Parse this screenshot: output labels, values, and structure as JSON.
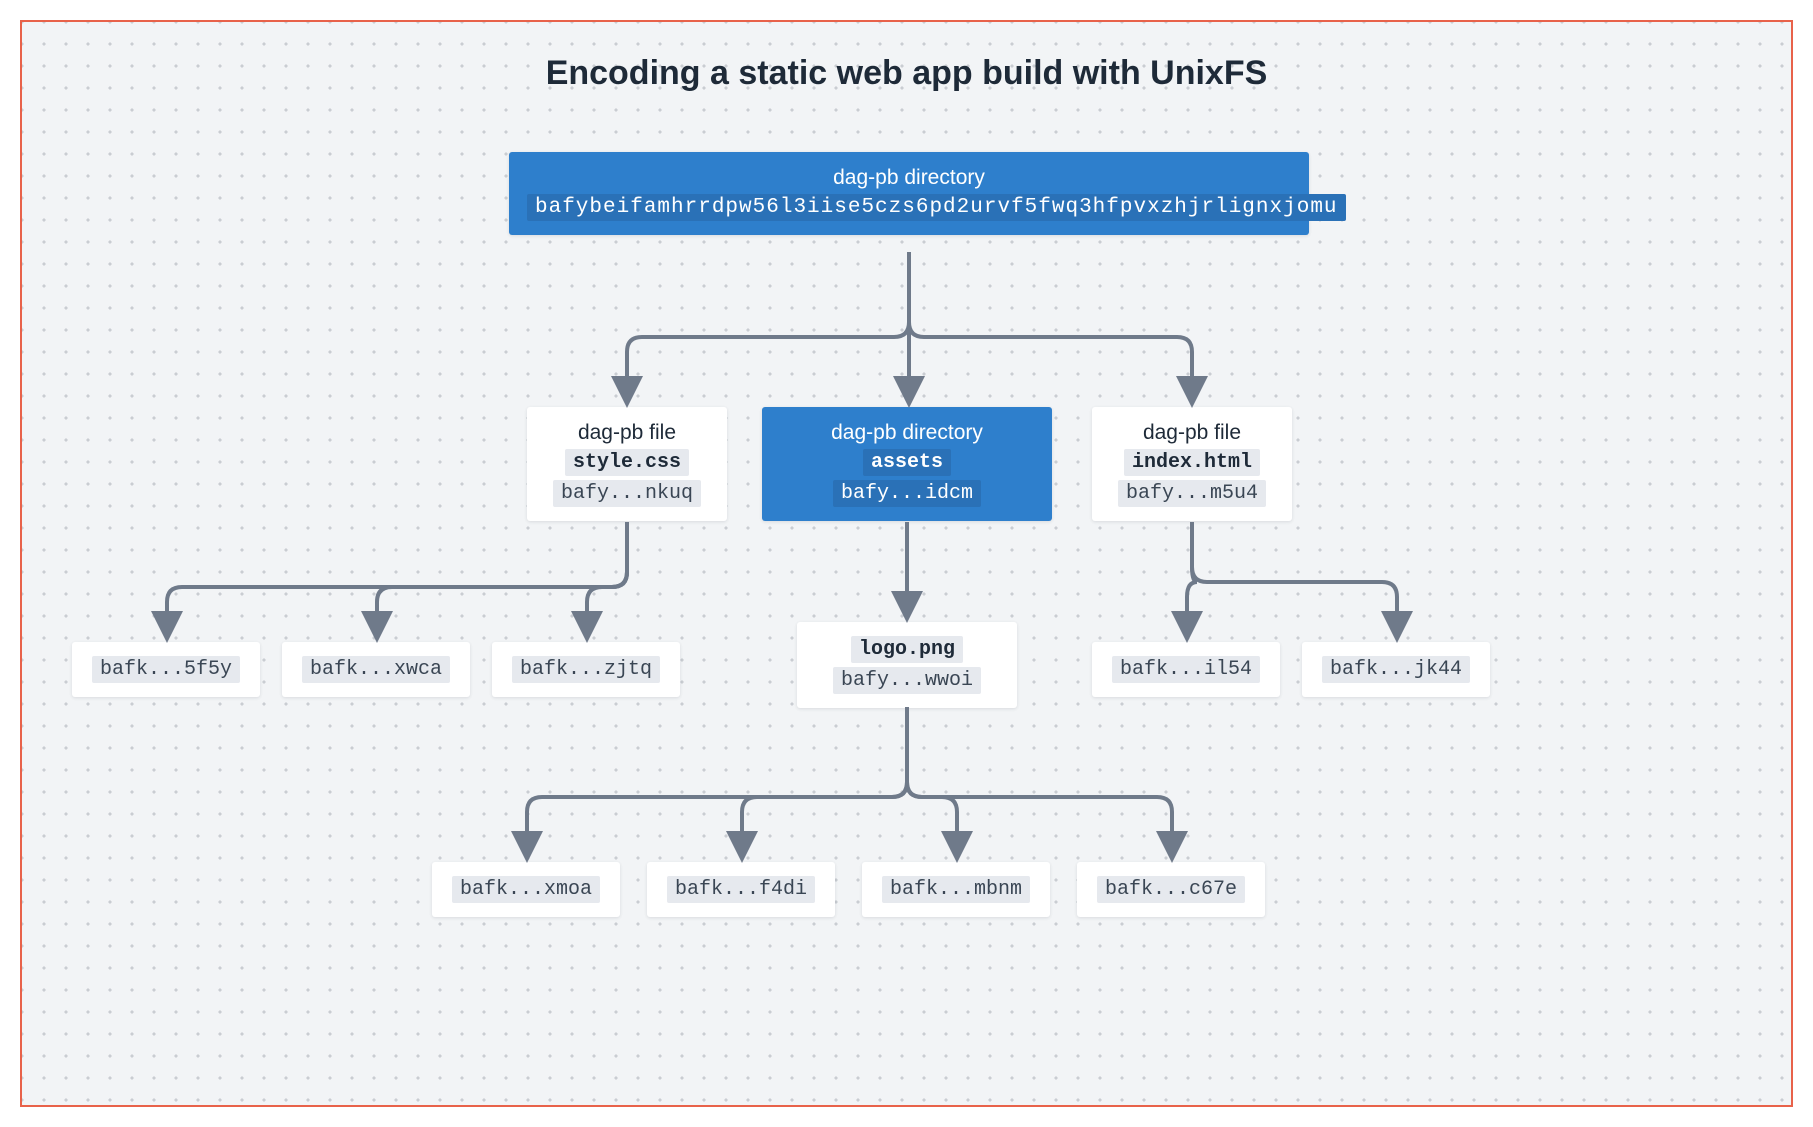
{
  "title": "Encoding a static web app build with UnixFS",
  "colors": {
    "accent": "#2e7fcc",
    "border": "#e8624a",
    "arrow": "#6f7a8a"
  },
  "root": {
    "type_label": "dag-pb directory",
    "cid": "bafybeifamhrrdpw56l3iise5czs6pd2urvf5fwq3hfpvxzhjrlignxjomu"
  },
  "children": {
    "style": {
      "type_label": "dag-pb file",
      "name": "style.css",
      "cid": "bafy...nkuq",
      "chunks": [
        "bafk...5f5y",
        "bafk...xwca",
        "bafk...zjtq"
      ]
    },
    "assets": {
      "type_label": "dag-pb directory",
      "name": "assets",
      "cid": "bafy...idcm",
      "logo": {
        "name": "logo.png",
        "cid": "bafy...wwoi",
        "chunks": [
          "bafk...xmoa",
          "bafk...f4di",
          "bafk...mbnm",
          "bafk...c67e"
        ]
      }
    },
    "index": {
      "type_label": "dag-pb file",
      "name": "index.html",
      "cid": "bafy...m5u4",
      "chunks": [
        "bafk...il54",
        "bafk...jk44"
      ]
    }
  }
}
